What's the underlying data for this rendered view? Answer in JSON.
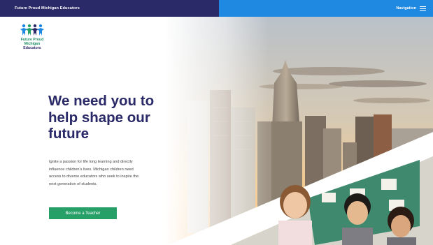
{
  "topbar": {
    "site_title": "Future Proud Michigan Educators",
    "nav_label": "Navigation"
  },
  "logo": {
    "line1": "Future Proud",
    "line2": "Michigan",
    "line3": "Educators"
  },
  "hero": {
    "headline_lines": [
      "We need you to",
      "help shape our",
      "future"
    ],
    "paragraph_lines": [
      "Ignite a passion for life long learning and directly",
      "influence children's lives. Michigan children need",
      "access to diverse educators who seek to inspire the",
      "next generation of students."
    ],
    "cta_label": "Become a Teacher"
  },
  "colors": {
    "navy": "#2b2a68",
    "blue": "#1f88e0",
    "green": "#27a068"
  },
  "icons": {
    "menu": "hamburger-icon",
    "logo": "people-figures-icon"
  }
}
